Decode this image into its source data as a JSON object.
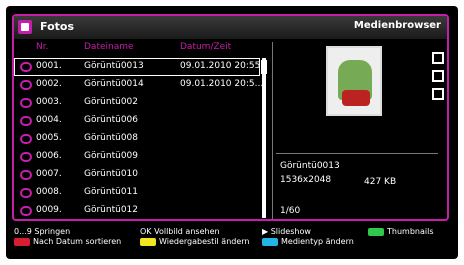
{
  "window": {
    "title": "Fotos",
    "mode_label": "Medienbrowser"
  },
  "columns": {
    "nr": "Nr.",
    "filename": "Dateiname",
    "datetime": "Datum/Zeit"
  },
  "files": [
    {
      "nr": "0001.",
      "name": "Görüntü0013",
      "datetime": "09.01.2010 20:55:."
    },
    {
      "nr": "0002.",
      "name": "Görüntü0014",
      "datetime": "09.01.2010 20:5..."
    },
    {
      "nr": "0003.",
      "name": "Görüntü002",
      "datetime": ""
    },
    {
      "nr": "0004.",
      "name": "Görüntü006",
      "datetime": ""
    },
    {
      "nr": "0005.",
      "name": "Görüntü008",
      "datetime": ""
    },
    {
      "nr": "0006.",
      "name": "Görüntü009",
      "datetime": ""
    },
    {
      "nr": "0007.",
      "name": "Görüntü010",
      "datetime": ""
    },
    {
      "nr": "0008.",
      "name": "Görüntü011",
      "datetime": ""
    },
    {
      "nr": "0009.",
      "name": "Görüntü012",
      "datetime": ""
    }
  ],
  "details": {
    "name": "Görüntü0013",
    "resolution": "1536x2048",
    "size": "427 KB",
    "position": "1/60"
  },
  "footer": {
    "jump_key": "0...9",
    "jump": "Springen",
    "sort_by_date": "Nach Datum sortieren",
    "ok_key": "OK",
    "fullscreen": "Vollbild ansehen",
    "playback_order": "Wiedergabestil ändern",
    "slideshow": "Slideshow",
    "media_type": "Medientyp ändern",
    "thumbnails": "Thumbnails"
  },
  "colors": {
    "accent": "#c51eaa",
    "red": "#d81e2e",
    "green": "#31c850",
    "yellow": "#f2e41f",
    "blue": "#24b4e6"
  }
}
